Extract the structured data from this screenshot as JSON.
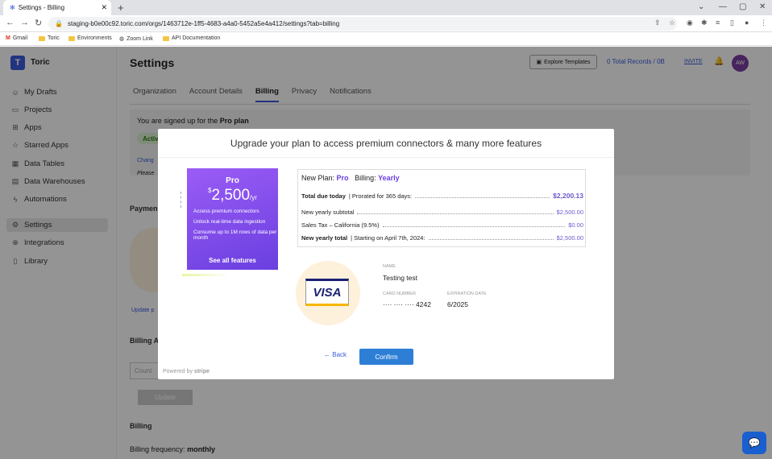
{
  "browser": {
    "tab_title": "Settings - Billing",
    "url": "staging-b0e00c92.toric.com/orgs/1463712e-1ff5-4683-a4a0-5452a5e4a412/settings?tab=billing",
    "bookmarks": [
      "Gmail",
      "Toric",
      "Environments",
      "Zoom Link",
      "API Documentation"
    ]
  },
  "app": {
    "brand": "Toric",
    "logo_letter": "T",
    "nav": [
      "My Drafts",
      "Projects",
      "Apps",
      "Starred Apps",
      "Data Tables",
      "Data Warehouses",
      "Automations",
      "Settings",
      "Integrations",
      "Library"
    ],
    "nav_icons": [
      "person-icon",
      "folder-icon",
      "apps-icon",
      "star-icon",
      "table-icon",
      "warehouse-icon",
      "bolt-icon",
      "gear-icon",
      "plug-icon",
      "book-icon"
    ],
    "active_nav": "Settings"
  },
  "header": {
    "title": "Settings",
    "explore": "Explore Templates",
    "records": "0 Total Records / 0B",
    "invite": "INVITE",
    "avatar": "AW"
  },
  "tabs": [
    "Organization",
    "Account Details",
    "Billing",
    "Privacy",
    "Notifications"
  ],
  "active_tab": "Billing",
  "billing_page": {
    "signed_up_prefix": "You are signed up for the",
    "plan_name": "Pro plan",
    "status_badge": "Activ",
    "change_link": "Chang",
    "please_text": "Please",
    "payment_heading": "Paymen",
    "update_link": "Update p",
    "billing_address_heading": "Billing A",
    "country_placeholder": "Count",
    "update_button": "Update",
    "billing_heading": "Billing",
    "frequency_label": "Billing frequency:",
    "frequency_value": "monthly"
  },
  "modal": {
    "title": "Upgrade your plan to access premium connectors & many more features",
    "plan_card": {
      "name": "Pro",
      "currency": "$",
      "price": "2,500",
      "period": "/yr",
      "features": [
        "Access premium connectors",
        "Unlock real-time data ingestion",
        "Consume up to 1M rows of data per month"
      ],
      "see_all": "See all features"
    },
    "summary": {
      "new_plan_label": "New Plan:",
      "new_plan_value": "Pro",
      "billing_label": "Billing:",
      "billing_value": "Yearly",
      "total_due_label": "Total due today",
      "total_due_note": "Prorated for 365 days:",
      "total_due_value": "$2,200.13",
      "subtotal_label": "New yearly subtotal",
      "subtotal_value": "$2,500.00",
      "tax_label": "Sales Tax – California (9.5%)",
      "tax_value": "$0.00",
      "yearly_total_label": "New yearly total",
      "yearly_total_note": "Starting on April 7th, 2024:",
      "yearly_total_value": "$2,500.00"
    },
    "card": {
      "brand": "VISA",
      "name_label": "NAME",
      "name": "Testing test",
      "number_label": "CARD NUMBER",
      "number": "···· ···· ···· 4242",
      "exp_label": "EXPIRATION DATE",
      "exp": "6/2025"
    },
    "back": "Back",
    "confirm": "Confirm",
    "powered_by": "Powered by",
    "stripe": "stripe"
  }
}
